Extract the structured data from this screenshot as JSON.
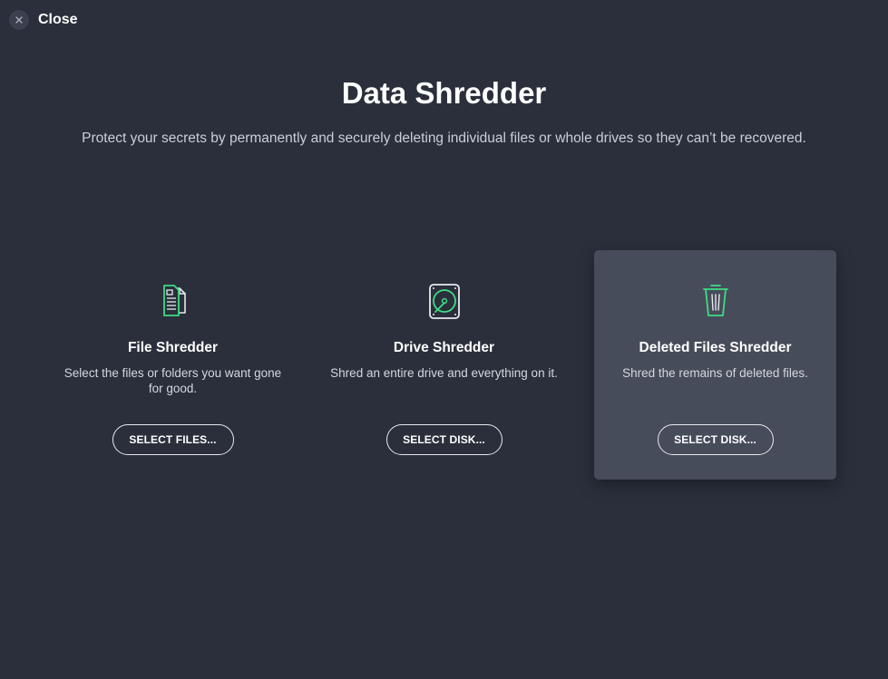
{
  "header": {
    "close_label": "Close",
    "close_icon": "close-icon"
  },
  "main": {
    "title": "Data Shredder",
    "subtitle": "Protect your secrets by permanently and securely deleting individual files or whole drives so they can’t be recovered."
  },
  "cards": [
    {
      "icon": "document-icon",
      "title": "File Shredder",
      "description": "Select the files or folders you want gone for good.",
      "button_label": "SELECT FILES...",
      "highlighted": false
    },
    {
      "icon": "hard-drive-icon",
      "title": "Drive Shredder",
      "description": "Shred an entire drive and everything on it.",
      "button_label": "SELECT DISK...",
      "highlighted": false
    },
    {
      "icon": "trash-icon",
      "title": "Deleted Files Shredder",
      "description": "Shred the remains of deleted files.",
      "button_label": "SELECT DISK...",
      "highlighted": true
    }
  ],
  "colors": {
    "background": "#2a2f3b",
    "card_highlight": "#474c5a",
    "icon_accent": "#3ddc84",
    "icon_outline": "#e8eaee"
  }
}
